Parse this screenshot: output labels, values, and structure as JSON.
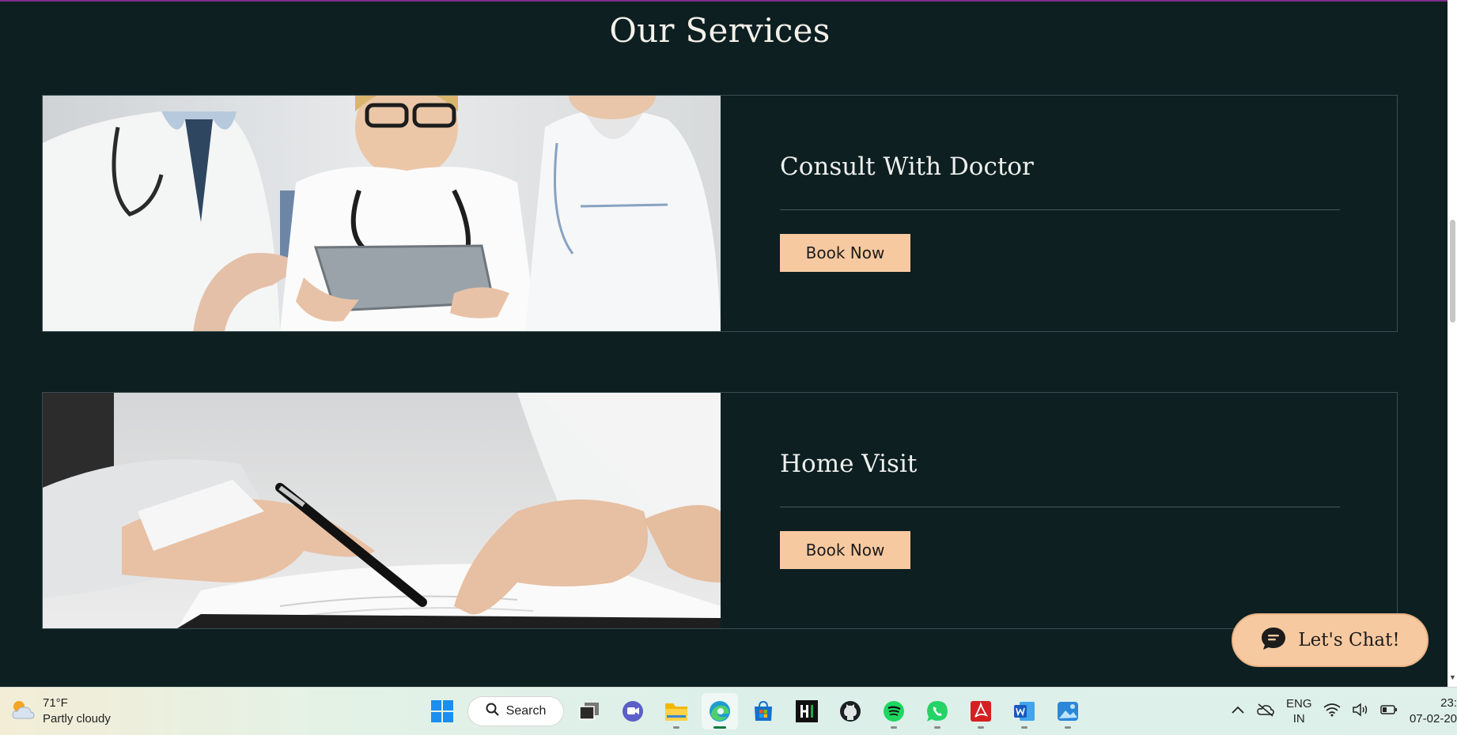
{
  "page": {
    "title": "Our Services",
    "services": [
      {
        "name": "Consult With Doctor",
        "button": "Book Now"
      },
      {
        "name": "Home Visit",
        "button": "Book Now"
      }
    ],
    "chat_button": "Let's Chat!"
  },
  "colors": {
    "background": "#0d1f21",
    "accent": "#f7c9a0",
    "card_border": "#3b4d51"
  },
  "taskbar": {
    "weather": {
      "temperature": "71°F",
      "condition": "Partly cloudy",
      "icon": "partly-cloudy-icon"
    },
    "search_label": "Search",
    "apps": [
      "windows-start-icon",
      "search",
      "task-view-icon",
      "teams-chat-icon",
      "file-explorer-icon",
      "edge-browser-icon",
      "microsoft-store-icon",
      "hackerrank-icon",
      "github-icon",
      "spotify-icon",
      "whatsapp-icon",
      "acrobat-icon",
      "word-icon",
      "photos-icon"
    ],
    "language": {
      "line1": "ENG",
      "line2": "IN"
    },
    "clock": {
      "time": "23:",
      "date": "07-02-20"
    }
  }
}
